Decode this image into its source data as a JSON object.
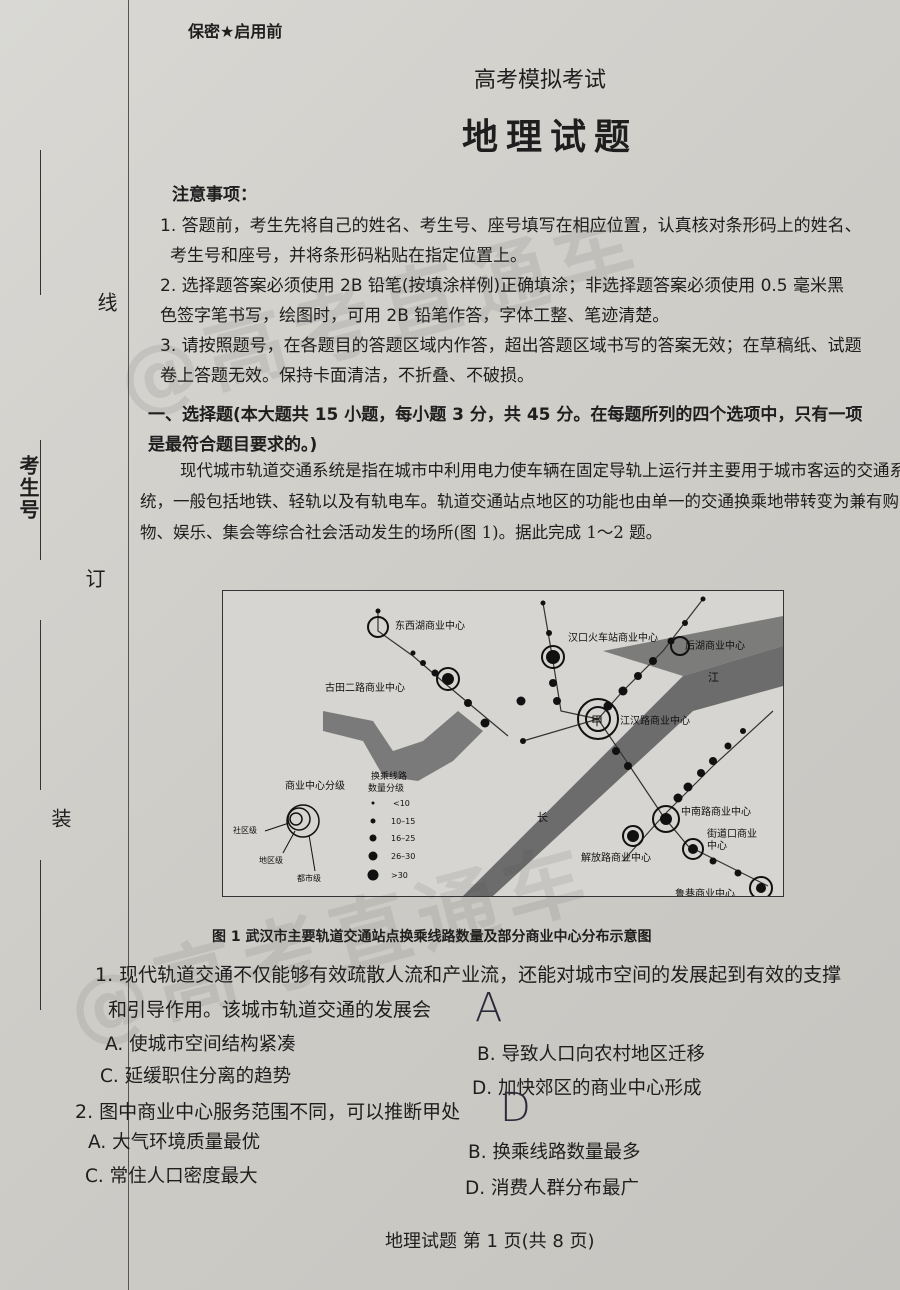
{
  "header": {
    "confidential": "保密★启用前",
    "subtitle": "高考模拟考试",
    "title": "地理试题"
  },
  "margin": {
    "line_label": "线",
    "order_label": "订",
    "bind_label": "装",
    "exam_no_label": "考生号"
  },
  "notice": {
    "heading": "注意事项：",
    "lines": [
      "1. 答题前，考生先将自己的姓名、考生号、座号填写在相应位置，认真核对条形码上的姓名、",
      "考生号和座号，并将条形码粘贴在指定位置上。",
      "2. 选择题答案必须使用 2B 铅笔(按填涂样例)正确填涂；非选择题答案必须使用 0.5 毫米黑",
      "色签字笔书写，绘图时，可用 2B 铅笔作答，字体工整、笔迹清楚。",
      "3. 请按照题号，在各题目的答题区域内作答，超出答题区域书写的答案无效；在草稿纸、试题",
      "卷上答题无效。保持卡面清洁，不折叠、不破损。"
    ]
  },
  "section": {
    "line1": "一、选择题(本大题共 15 小题，每小题 3 分，共 45 分。在每题所列的四个选项中，只有一项",
    "line2": "是最符合题目要求的。)"
  },
  "passage": "现代城市轨道交通系统是指在城市中利用电力使车辆在固定导轨上运行并主要用于城市客运的交通系统，一般包括地铁、轻轨以及有轨电车。轨道交通站点地区的功能也由单一的交通换乘地带转变为兼有购物、娱乐、集会等综合社会活动发生的场所(图 1)。据此完成 1～2 题。",
  "figure": {
    "labels": {
      "dongxihu": "东西湖商业中心",
      "hankou": "汉口火车站商业中心",
      "shihu": "后湖商业中心",
      "gutian": "古田二路商业中心",
      "jianghan": "江汉路商业中心",
      "zhongnan": "中南路商业中心",
      "jiedao": "街道口商业",
      "jiedao2": "中心",
      "jiefang": "解放路商业中心",
      "luxiang": "鲁巷商业中心",
      "jia": "甲",
      "river1": "江",
      "river2": "长"
    },
    "legend": {
      "center_title": "商业中心分级",
      "community": "社区级",
      "district": "地区级",
      "city": "都市级",
      "transfer_title": "换乘线路",
      "transfer_title2": "数量分级",
      "t1": "<10",
      "t2": "10–15",
      "t3": "16–25",
      "t4": "26–30",
      "t5": ">30"
    },
    "caption": "图 1   武汉市主要轨道交通站点换乘线路数量及部分商业中心分布示意图"
  },
  "questions": [
    {
      "stem1": "1. 现代轨道交通不仅能够有效疏散人流和产业流，还能对城市空间的发展起到有效的支撑",
      "stem2": "和引导作用。该城市轨道交通的发展会",
      "handwritten": "A",
      "options": [
        "A. 使城市空间结构紧凑",
        "B. 导致人口向农村地区迁移",
        "C. 延缓职住分离的趋势",
        "D. 加快郊区的商业中心形成"
      ]
    },
    {
      "stem1": "2. 图中商业中心服务范围不同，可以推断甲处",
      "handwritten": "D",
      "options": [
        "A. 大气环境质量最优",
        "B. 换乘线路数量最多",
        "C. 常住人口密度最大",
        "D. 消费人群分布最广"
      ]
    }
  ],
  "footer": "地理试题   第 1 页(共 8 页)",
  "watermark": "@高考直通车"
}
